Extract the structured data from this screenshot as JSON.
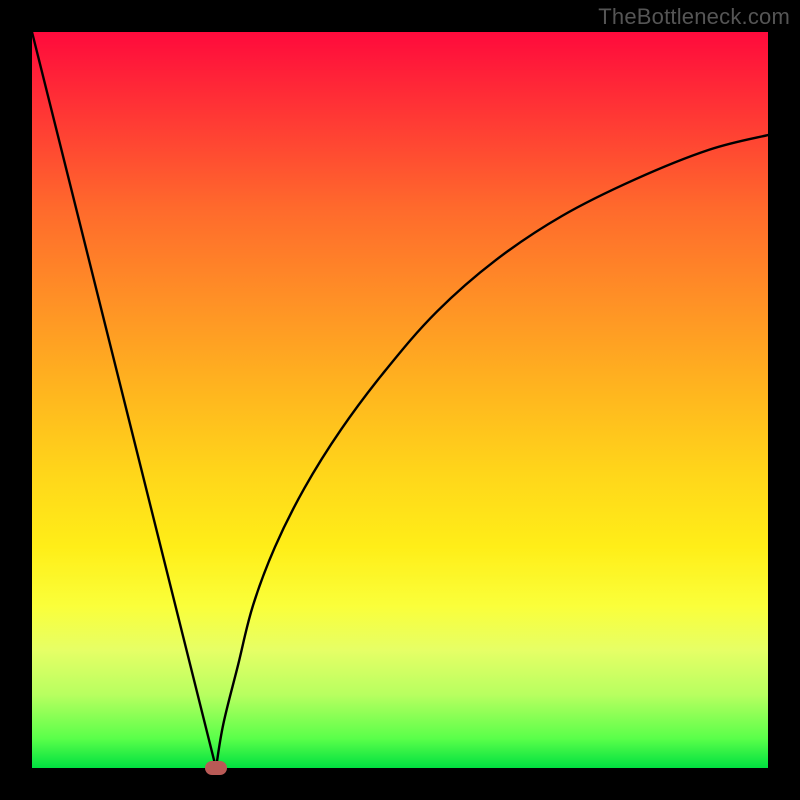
{
  "watermark": "TheBottleneck.com",
  "chart_data": {
    "type": "line",
    "title": "",
    "xlabel": "",
    "ylabel": "",
    "xlim": [
      0,
      100
    ],
    "ylim": [
      0,
      100
    ],
    "grid": false,
    "legend": false,
    "series": [
      {
        "name": "left-branch",
        "x": [
          0,
          5,
          10,
          15,
          20,
          25
        ],
        "y": [
          100,
          80,
          60,
          40,
          20,
          0
        ]
      },
      {
        "name": "right-branch",
        "x": [
          25,
          26,
          28,
          30,
          33,
          37,
          42,
          48,
          55,
          63,
          72,
          82,
          92,
          100
        ],
        "y": [
          0,
          6,
          14,
          22,
          30,
          38,
          46,
          54,
          62,
          69,
          75,
          80,
          84,
          86
        ]
      }
    ],
    "marker": {
      "x": 25,
      "y": 0
    },
    "gradient_stops": [
      {
        "pct": 0,
        "color": "#ff0a3c"
      },
      {
        "pct": 50,
        "color": "#ffd61a"
      },
      {
        "pct": 80,
        "color": "#faff3a"
      },
      {
        "pct": 100,
        "color": "#00e040"
      }
    ]
  }
}
